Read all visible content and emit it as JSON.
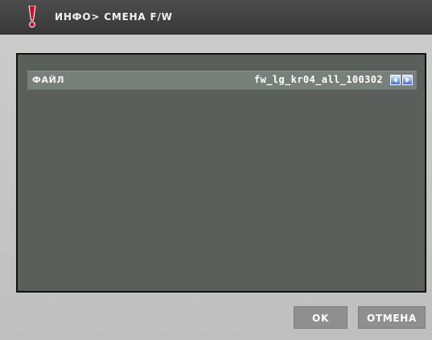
{
  "header": {
    "title": "ИНФО> СМЕНА  F/W",
    "warning_icon": "exclamation-icon"
  },
  "file": {
    "label": "ФАЙЛ",
    "value": "fw_lg_kr04_all_100302",
    "left_icon": "arrow-left-icon",
    "right_icon": "arrow-right-icon"
  },
  "buttons": {
    "ok": "OK",
    "cancel": "ОТМЕНА"
  },
  "colors": {
    "header_bg": "#444444",
    "panel_bg": "#5b5f5c",
    "row_highlight": "#78807b",
    "button_bg": "#8f8f8f",
    "arrow_blue": "#3b6fd6"
  }
}
